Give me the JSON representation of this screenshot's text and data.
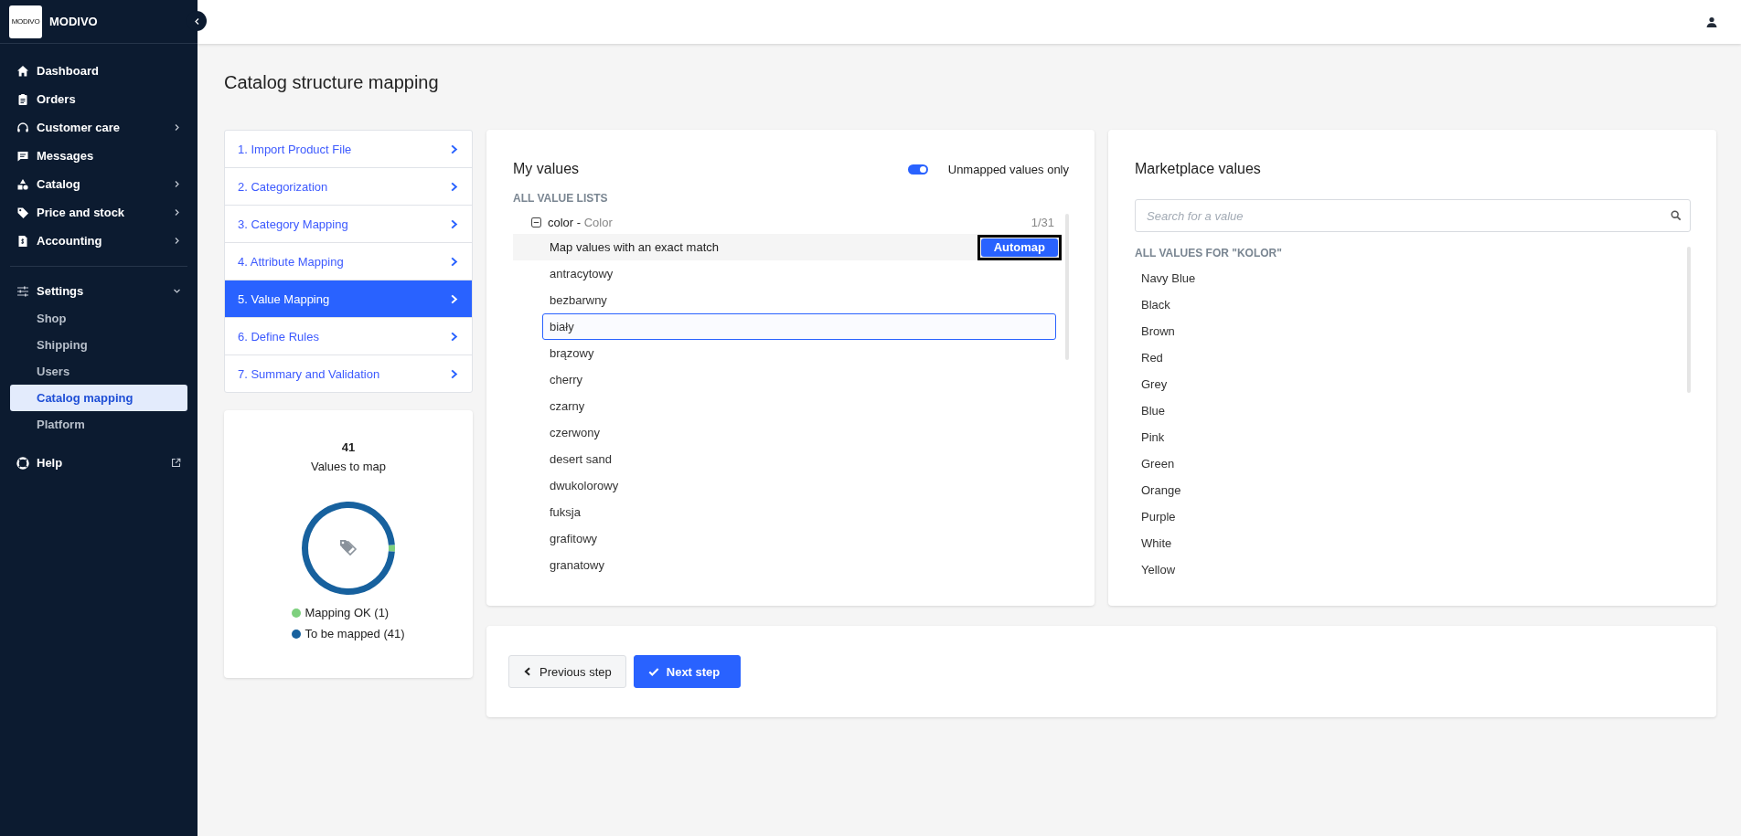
{
  "sidebar": {
    "logo_text": "MODIVO",
    "brand": "MODIVO",
    "nav": [
      {
        "label": "Dashboard",
        "has_submenu": false,
        "selected": false
      },
      {
        "label": "Orders",
        "has_submenu": false,
        "selected": false
      },
      {
        "label": "Customer care",
        "has_submenu": true,
        "selected": false
      },
      {
        "label": "Messages",
        "has_submenu": false,
        "selected": false
      },
      {
        "label": "Catalog",
        "has_submenu": true,
        "selected": false
      },
      {
        "label": "Price and stock",
        "has_submenu": true,
        "selected": false
      },
      {
        "label": "Accounting",
        "has_submenu": true,
        "selected": false
      }
    ],
    "settings": {
      "label": "Settings",
      "expanded": true,
      "children": [
        {
          "label": "Shop",
          "selected": false
        },
        {
          "label": "Shipping",
          "selected": false
        },
        {
          "label": "Users",
          "selected": false
        },
        {
          "label": "Catalog mapping",
          "selected": true
        },
        {
          "label": "Platform",
          "selected": false
        }
      ]
    },
    "help": {
      "label": "Help"
    }
  },
  "page_title": "Catalog structure mapping",
  "steps": [
    {
      "label": "1. Import Product File",
      "selected": false
    },
    {
      "label": "2. Categorization",
      "selected": false
    },
    {
      "label": "3. Category Mapping",
      "selected": false
    },
    {
      "label": "4. Attribute Mapping",
      "selected": false
    },
    {
      "label": "5. Value Mapping",
      "selected": true
    },
    {
      "label": "6. Define Rules",
      "selected": false
    },
    {
      "label": "7. Summary and Validation",
      "selected": false
    }
  ],
  "stats": {
    "count": "41",
    "caption": "Values to map",
    "chart_data": {
      "type": "donut",
      "values": [
        2.38,
        97.62
      ]
    },
    "legend": [
      {
        "label": "Mapping OK (1)",
        "color": "#7ed07e"
      },
      {
        "label": "To be mapped (41)",
        "color": "#17619e"
      }
    ]
  },
  "my_values": {
    "title": "My values",
    "toggle": {
      "label": "Unmapped values only",
      "on": true
    },
    "section": "ALL VALUE LISTS",
    "group": {
      "name": "color",
      "separator": " - ",
      "label": "Color",
      "count": "1/31",
      "expanded": true,
      "automap": {
        "text": "Map values with an exact match",
        "button": "Automap",
        "focused": true
      },
      "values": [
        {
          "label": "antracytowy",
          "selected": false
        },
        {
          "label": "bezbarwny",
          "selected": false
        },
        {
          "label": "biały",
          "selected": true
        },
        {
          "label": "brązowy",
          "selected": false
        },
        {
          "label": "cherry",
          "selected": false
        },
        {
          "label": "czarny",
          "selected": false
        },
        {
          "label": "czerwony",
          "selected": false
        },
        {
          "label": "desert sand",
          "selected": false
        },
        {
          "label": "dwukolorowy",
          "selected": false
        },
        {
          "label": "fuksja",
          "selected": false
        },
        {
          "label": "grafitowy",
          "selected": false
        },
        {
          "label": "granatowy",
          "selected": false
        }
      ]
    }
  },
  "marketplace": {
    "title": "Marketplace values",
    "search": {
      "placeholder": "Search for a value"
    },
    "section": "ALL VALUES FOR \"KOLOR\"",
    "values": [
      "Navy Blue",
      "Black",
      "Brown",
      "Red",
      "Grey",
      "Blue",
      "Pink",
      "Green",
      "Orange",
      "Purple",
      "White",
      "Yellow"
    ]
  },
  "footer": {
    "buttons": [
      {
        "label": "Previous step",
        "kind": "back"
      },
      {
        "label": "Next step",
        "kind": "primary"
      }
    ]
  }
}
